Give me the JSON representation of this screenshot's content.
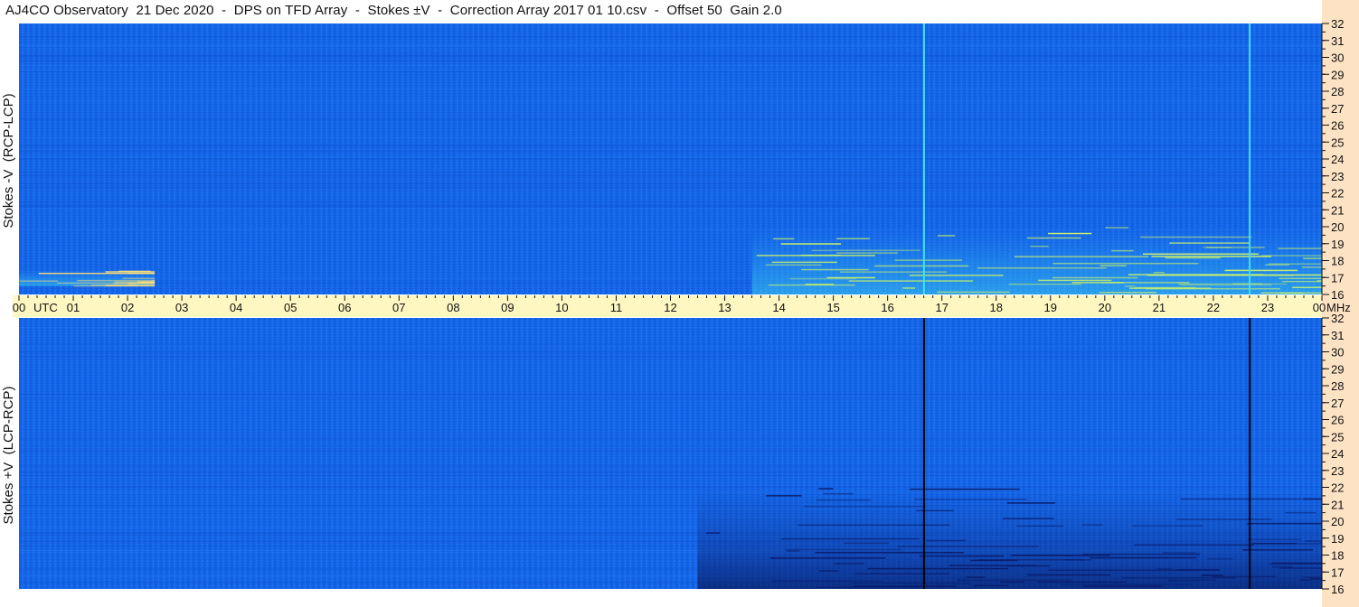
{
  "title": "AJ4CO Observatory  21 Dec 2020  -  DPS on TFD Array  -  Stokes ±V  -  Correction Array 2017 01 10.csv  -  Offset 50  Gain 2.0",
  "colors": {
    "panel_blue": "#1565e8",
    "panel_blue_dark": "#0e4fc9",
    "axis_bar": "#fff7c2",
    "right_strip": "#fde3c4",
    "bright_cyan": "#3fe0ff",
    "yellow_green": "#c8f06a",
    "dark_band": "#0a1c6b"
  },
  "chart_data": [
    {
      "type": "heatmap",
      "panel": "top",
      "ylabel": "Stokes -V  (RCP-LCP)",
      "x_unit": "UTC",
      "y_unit": "MHz",
      "xlim": [
        0,
        24
      ],
      "ylim": [
        16,
        32
      ],
      "y_ticks": [
        32,
        31,
        30,
        29,
        28,
        27,
        26,
        25,
        24,
        23,
        22,
        21,
        20,
        19,
        18,
        17,
        16
      ],
      "vertical_lines_utc": [
        16.67,
        22.67
      ],
      "vertical_line_color": "#3fe0ff",
      "activity": [
        {
          "utc_start": 13.5,
          "utc_end": 24,
          "mhz_low": 16,
          "mhz_high": 20,
          "description_color": "#c8f06a"
        },
        {
          "utc_start": 0,
          "utc_end": 2.5,
          "mhz_low": 16.5,
          "mhz_high": 17.5,
          "description_color": "#ffe07a"
        }
      ]
    },
    {
      "type": "heatmap",
      "panel": "bottom",
      "ylabel": "Stokes +V  (LCP-RCP)",
      "x_unit": "UTC",
      "y_unit": "MHz",
      "xlim": [
        0,
        24
      ],
      "ylim": [
        16,
        32
      ],
      "y_ticks": [
        32,
        31,
        30,
        29,
        28,
        27,
        26,
        25,
        24,
        23,
        22,
        21,
        20,
        19,
        18,
        17,
        16
      ],
      "vertical_lines_utc": [
        16.67,
        22.67
      ],
      "vertical_line_color": "#000000",
      "activity": [
        {
          "utc_start": 12.5,
          "utc_end": 24,
          "mhz_low": 16,
          "mhz_high": 22,
          "description_color": "#0a1c6b"
        }
      ]
    }
  ],
  "time_axis": {
    "start_label": "00",
    "unit_label": "UTC",
    "end_label": "00",
    "end_unit": "MHz",
    "hour_labels": [
      "01",
      "02",
      "03",
      "04",
      "05",
      "06",
      "07",
      "08",
      "09",
      "10",
      "11",
      "12",
      "13",
      "14",
      "15",
      "16",
      "17",
      "18",
      "19",
      "20",
      "21",
      "22",
      "23"
    ]
  }
}
